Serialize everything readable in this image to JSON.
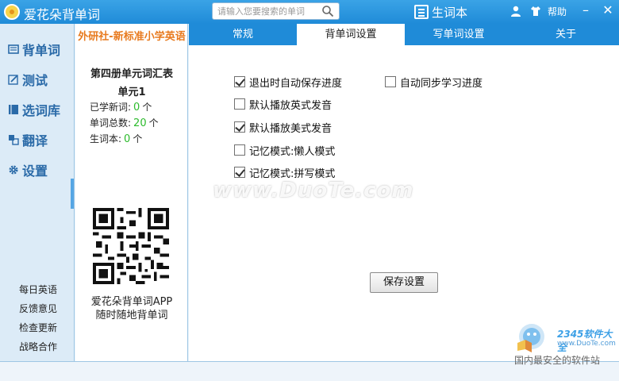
{
  "titlebar": {
    "app_title": "爱花朵背单词",
    "search_placeholder": "请输入您要搜索的单词",
    "vocab_book_label": "生词本",
    "help_label": "帮助",
    "minimize_glyph": "–",
    "close_glyph": "✕"
  },
  "nav": {
    "items": [
      {
        "label": "背单词",
        "icon": "book-icon"
      },
      {
        "label": "测试",
        "icon": "edit-icon"
      },
      {
        "label": "选词库",
        "icon": "library-icon"
      },
      {
        "label": "翻译",
        "icon": "translate-icon"
      },
      {
        "label": "设置",
        "icon": "gear-icon"
      }
    ],
    "links": [
      "每日英语",
      "反馈意见",
      "检查更新",
      "战略合作"
    ]
  },
  "book": {
    "publisher": "外研社-新标准小学英语",
    "name": "第四册单元词汇表",
    "unit": "单元1",
    "stats": [
      {
        "label": "已学新词:",
        "value": "0",
        "unit": "个"
      },
      {
        "label": "单词总数:",
        "value": "20",
        "unit": "个"
      },
      {
        "label": "生词本:",
        "value": "0",
        "unit": "个"
      }
    ],
    "promo_line1": "爱花朵背单词APP",
    "promo_line2": "随时随地背单词"
  },
  "tabs": [
    {
      "label": "常规",
      "active": false
    },
    {
      "label": "背单词设置",
      "active": true
    },
    {
      "label": "写单词设置",
      "active": false
    },
    {
      "label": "关于",
      "active": false
    }
  ],
  "settings": {
    "options": [
      {
        "label": "退出时自动保存进度",
        "checked": true
      },
      {
        "label": "自动同步学习进度",
        "checked": false
      },
      {
        "label": "默认播放英式发音",
        "checked": false
      },
      {
        "label": "默认播放美式发音",
        "checked": true
      },
      {
        "label": "记忆模式:懒人模式",
        "checked": false
      },
      {
        "label": "记忆模式:拼写模式",
        "checked": true
      }
    ],
    "save_label": "保存设置"
  },
  "watermark": "www.DuoTe.com",
  "corner": {
    "name": "2345软件大全",
    "url": "www.DuoTe.com",
    "slogan": "国内最安全的软件站"
  },
  "colors": {
    "titlebar": "#1f8bd8",
    "accent_orange": "#e87a1e",
    "stat_green": "#2dbb2d",
    "nav_text": "#2a6aa8"
  }
}
